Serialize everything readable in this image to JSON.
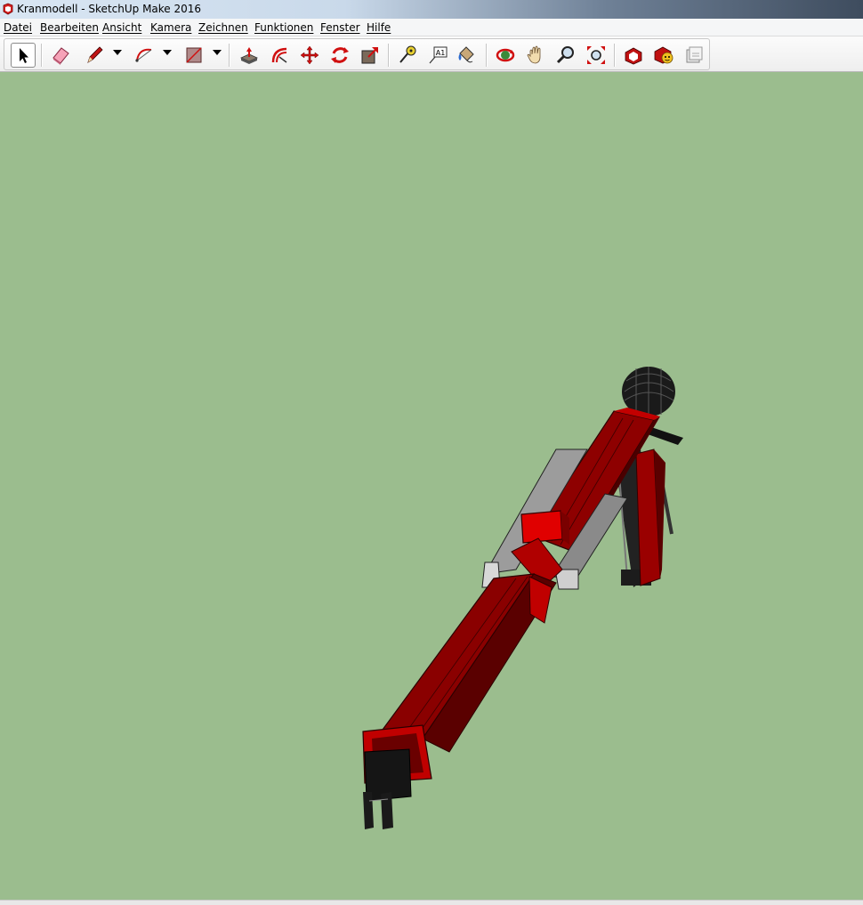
{
  "window": {
    "title": "Kranmodell - SketchUp Make 2016"
  },
  "menu": {
    "items": [
      {
        "label": "Datei"
      },
      {
        "label": "Bearbeiten"
      },
      {
        "label": "Ansicht"
      },
      {
        "label": "Kamera"
      },
      {
        "label": "Zeichnen"
      },
      {
        "label": "Funktionen"
      },
      {
        "label": "Fenster"
      },
      {
        "label": "Hilfe"
      }
    ]
  },
  "toolbar": {
    "tools": [
      {
        "name": "select-tool",
        "icon": "arrow-cursor-icon",
        "active": true
      },
      {
        "name": "eraser-tool",
        "icon": "eraser-icon"
      },
      {
        "name": "pencil-tool",
        "icon": "pencil-icon"
      },
      {
        "name": "arc-tool",
        "icon": "arc-icon"
      },
      {
        "name": "rectangle-tool",
        "icon": "rectangle-icon"
      },
      {
        "name": "push-pull-tool",
        "icon": "push-pull-icon"
      },
      {
        "name": "offset-tool",
        "icon": "offset-icon"
      },
      {
        "name": "move-tool",
        "icon": "move-icon"
      },
      {
        "name": "rotate-tool",
        "icon": "rotate-icon"
      },
      {
        "name": "scale-tool",
        "icon": "scale-icon"
      },
      {
        "name": "tape-measure-tool",
        "icon": "tape-measure-icon"
      },
      {
        "name": "text-tool",
        "icon": "text-label-icon",
        "label": "A1"
      },
      {
        "name": "paint-bucket-tool",
        "icon": "paint-bucket-icon"
      },
      {
        "name": "orbit-tool",
        "icon": "orbit-icon"
      },
      {
        "name": "pan-tool",
        "icon": "hand-icon"
      },
      {
        "name": "zoom-tool",
        "icon": "magnifier-icon"
      },
      {
        "name": "zoom-extents-tool",
        "icon": "zoom-extents-icon"
      },
      {
        "name": "3d-warehouse-tool",
        "icon": "warehouse-icon"
      },
      {
        "name": "extension-warehouse-tool",
        "icon": "extension-warehouse-icon"
      },
      {
        "name": "layout-send-tool",
        "icon": "send-to-layout-icon"
      }
    ]
  },
  "colors": {
    "viewport_background": "#9bbd8e",
    "model_red": "#8b0000",
    "model_bright_red": "#e00000",
    "model_gray": "#9a9a9a",
    "model_dark": "#1a1a1a"
  }
}
